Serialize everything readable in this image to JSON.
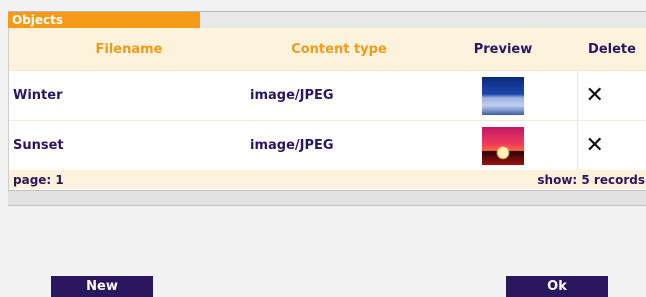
{
  "tab": {
    "label": "Objects"
  },
  "columns": {
    "filename": "Filename",
    "content_type": "Content type",
    "preview": "Preview",
    "delete": "Delete"
  },
  "rows": [
    {
      "filename": "Winter",
      "content_type": "image/JPEG",
      "preview": "winter-thumbnail",
      "delete_icon": "close-icon"
    },
    {
      "filename": "Sunset",
      "content_type": "image/JPEG",
      "preview": "sunset-thumbnail",
      "delete_icon": "close-icon"
    }
  ],
  "footer": {
    "page": "page: 1",
    "show": "show: 5 records"
  },
  "buttons": {
    "new": "New",
    "ok": "Ok"
  },
  "colors": {
    "accent": "#f59a16",
    "primary": "#2b1660",
    "header_bg": "#fdf3dc"
  }
}
